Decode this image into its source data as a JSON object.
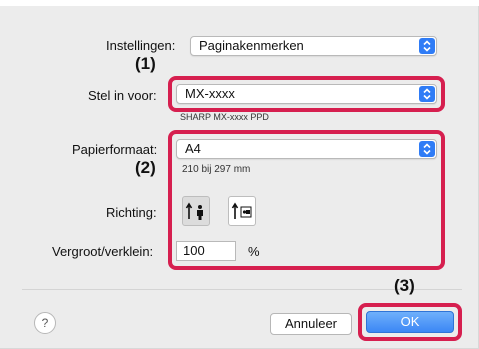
{
  "settings": {
    "label": "Instellingen:",
    "value": "Paginakenmerken"
  },
  "format_for": {
    "label": "Stel in voor:",
    "value": "MX-xxxx",
    "subtitle": "SHARP MX-xxxx PPD"
  },
  "paper_size": {
    "label": "Papierformaat:",
    "value": "A4",
    "dimensions": "210 bij 297 mm"
  },
  "orientation": {
    "label": "Richting:",
    "options": [
      "portrait-icon",
      "landscape-icon"
    ],
    "selected": "portrait-icon"
  },
  "scale": {
    "label": "Vergroot/verklein:",
    "value": "100",
    "unit": "%"
  },
  "buttons": {
    "help": "?",
    "cancel": "Annuleer",
    "ok": "OK"
  },
  "callouts": [
    "(1)",
    "(2)",
    "(3)"
  ],
  "colors": {
    "highlight": "#d61f4f",
    "accent": "#2f7cf6",
    "ok_button": "#3b87f5"
  }
}
